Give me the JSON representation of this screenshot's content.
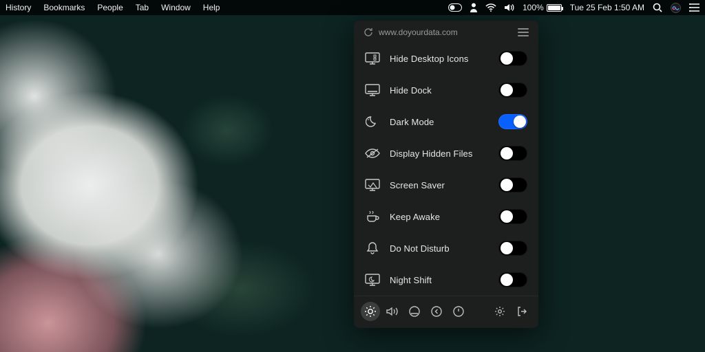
{
  "menubar": {
    "left_items": [
      "History",
      "Bookmarks",
      "People",
      "Tab",
      "Window",
      "Help"
    ],
    "battery_pct": "100%",
    "datetime": "Tue 25 Feb  1:50 AM"
  },
  "panel": {
    "site_label": "www.doyourdata.com",
    "toggles": [
      {
        "id": "hide-desktop-icons",
        "label": "Hide Desktop Icons",
        "on": false,
        "icon": "desktop-icons-icon"
      },
      {
        "id": "hide-dock",
        "label": "Hide Dock",
        "on": false,
        "icon": "dock-icon"
      },
      {
        "id": "dark-mode",
        "label": "Dark Mode",
        "on": true,
        "icon": "moon-icon"
      },
      {
        "id": "display-hidden-files",
        "label": "Display Hidden Files",
        "on": false,
        "icon": "eye-slash-icon"
      },
      {
        "id": "screen-saver",
        "label": "Screen Saver",
        "on": false,
        "icon": "screensaver-icon"
      },
      {
        "id": "keep-awake",
        "label": "Keep Awake",
        "on": false,
        "icon": "coffee-icon"
      },
      {
        "id": "do-not-disturb",
        "label": "Do Not Disturb",
        "on": false,
        "icon": "bell-icon"
      },
      {
        "id": "night-shift",
        "label": "Night Shift",
        "on": false,
        "icon": "nightshift-icon"
      }
    ],
    "footer_actions": [
      {
        "id": "brightness",
        "icon": "brightness-icon",
        "active": true
      },
      {
        "id": "volume",
        "icon": "speaker-icon",
        "active": false
      },
      {
        "id": "display",
        "icon": "display-circle-icon",
        "active": false
      },
      {
        "id": "back",
        "icon": "arrow-left-circle-icon",
        "active": false
      },
      {
        "id": "power",
        "icon": "power-icon",
        "active": false
      }
    ],
    "footer_right": [
      {
        "id": "settings",
        "icon": "gear-icon"
      },
      {
        "id": "exit",
        "icon": "exit-icon"
      }
    ]
  }
}
